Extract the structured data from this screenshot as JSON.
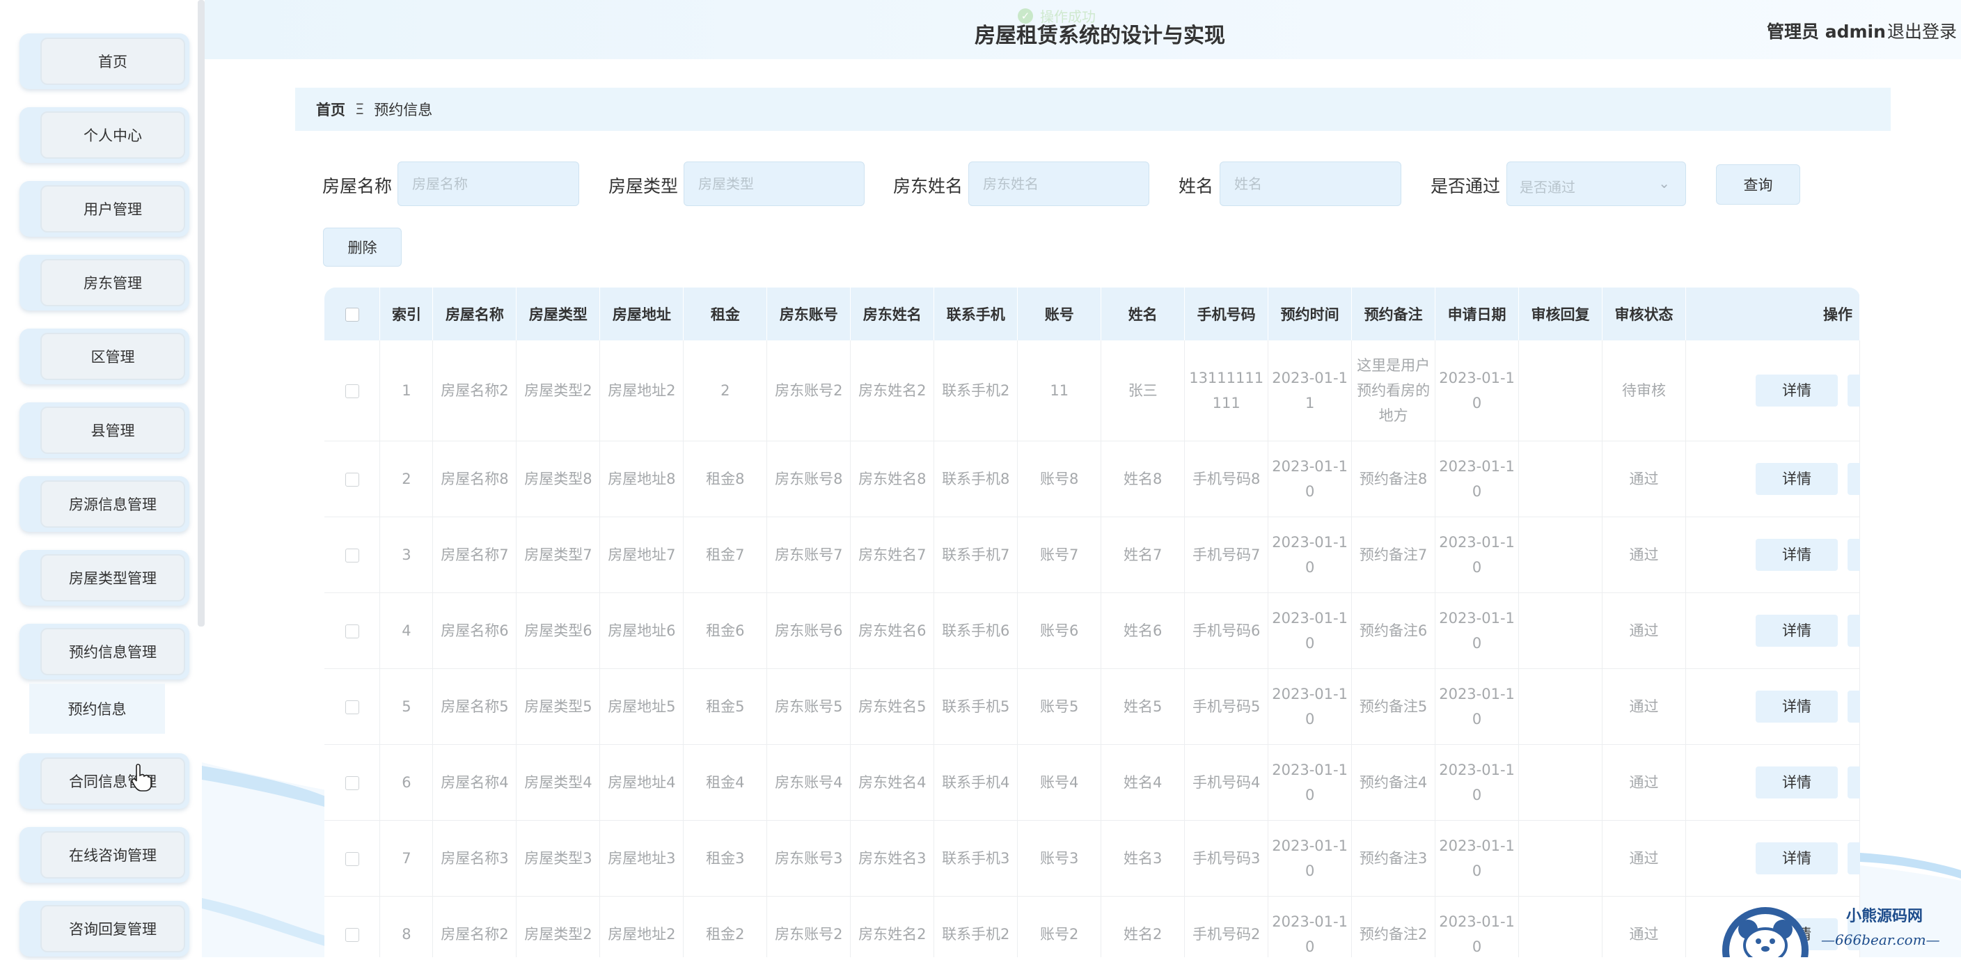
{
  "app": {
    "title": "房屋租赁系统的设计与实现",
    "admin": "管理员 admin",
    "logout": "退出登录"
  },
  "toast": {
    "text": "操作成功"
  },
  "sidebar": {
    "items": [
      {
        "label": "首页"
      },
      {
        "label": "个人中心"
      },
      {
        "label": "用户管理"
      },
      {
        "label": "房东管理"
      },
      {
        "label": "区管理"
      },
      {
        "label": "县管理"
      },
      {
        "label": "房源信息管理"
      },
      {
        "label": "房屋类型管理"
      },
      {
        "label": "预约信息管理"
      },
      {
        "label": "合同信息管理"
      },
      {
        "label": "在线咨询管理"
      },
      {
        "label": "咨询回复管理"
      }
    ],
    "submenu": {
      "label": "预约信息"
    }
  },
  "breadcrumb": {
    "home": "首页",
    "separator": "Ξ",
    "current": "预约信息"
  },
  "search": {
    "house_name": {
      "label": "房屋名称",
      "placeholder": "房屋名称"
    },
    "house_type": {
      "label": "房屋类型",
      "placeholder": "房屋类型"
    },
    "landlord_name": {
      "label": "房东姓名",
      "placeholder": "房东姓名"
    },
    "name": {
      "label": "姓名",
      "placeholder": "姓名"
    },
    "approved": {
      "label": "是否通过",
      "placeholder": "是否通过"
    },
    "query_button": "查询",
    "delete_button": "删除"
  },
  "table": {
    "headers": [
      "索引",
      "房屋名称",
      "房屋类型",
      "房屋地址",
      "租金",
      "房东账号",
      "房东姓名",
      "联系手机",
      "账号",
      "姓名",
      "手机号码",
      "预约时间",
      "预约备注",
      "申请日期",
      "审核回复",
      "审核状态",
      "操作"
    ],
    "rows": [
      [
        "1",
        "房屋名称2",
        "房屋类型2",
        "房屋地址2",
        "2",
        "房东账号2",
        "房东姓名2",
        "联系手机2",
        "11",
        "张三",
        "13111111111",
        "2023-01-11",
        "这里是用户预约看房的地方",
        "2023-01-10",
        "",
        "待审核"
      ],
      [
        "2",
        "房屋名称8",
        "房屋类型8",
        "房屋地址8",
        "租金8",
        "房东账号8",
        "房东姓名8",
        "联系手机8",
        "账号8",
        "姓名8",
        "手机号码8",
        "2023-01-10",
        "预约备注8",
        "2023-01-10",
        "",
        "通过"
      ],
      [
        "3",
        "房屋名称7",
        "房屋类型7",
        "房屋地址7",
        "租金7",
        "房东账号7",
        "房东姓名7",
        "联系手机7",
        "账号7",
        "姓名7",
        "手机号码7",
        "2023-01-10",
        "预约备注7",
        "2023-01-10",
        "",
        "通过"
      ],
      [
        "4",
        "房屋名称6",
        "房屋类型6",
        "房屋地址6",
        "租金6",
        "房东账号6",
        "房东姓名6",
        "联系手机6",
        "账号6",
        "姓名6",
        "手机号码6",
        "2023-01-10",
        "预约备注6",
        "2023-01-10",
        "",
        "通过"
      ],
      [
        "5",
        "房屋名称5",
        "房屋类型5",
        "房屋地址5",
        "租金5",
        "房东账号5",
        "房东姓名5",
        "联系手机5",
        "账号5",
        "姓名5",
        "手机号码5",
        "2023-01-10",
        "预约备注5",
        "2023-01-10",
        "",
        "通过"
      ],
      [
        "6",
        "房屋名称4",
        "房屋类型4",
        "房屋地址4",
        "租金4",
        "房东账号4",
        "房东姓名4",
        "联系手机4",
        "账号4",
        "姓名4",
        "手机号码4",
        "2023-01-10",
        "预约备注4",
        "2023-01-10",
        "",
        "通过"
      ],
      [
        "7",
        "房屋名称3",
        "房屋类型3",
        "房屋地址3",
        "租金3",
        "房东账号3",
        "房东姓名3",
        "联系手机3",
        "账号3",
        "姓名3",
        "手机号码3",
        "2023-01-10",
        "预约备注3",
        "2023-01-10",
        "",
        "通过"
      ],
      [
        "8",
        "房屋名称2",
        "房屋类型2",
        "房屋地址2",
        "租金2",
        "房东账号2",
        "房东姓名2",
        "联系手机2",
        "账号2",
        "姓名2",
        "手机号码2",
        "2023-01-10",
        "预约备注2",
        "2023-01-10",
        "",
        "通过"
      ]
    ],
    "detail_button": "详情"
  },
  "watermark": {
    "line1": "小熊源码网",
    "line2": "—666bear.com—"
  },
  "colors": {
    "accent": "#e5f2fc",
    "header_bg": "#eaf5fc",
    "text": "#333333",
    "muted": "#a5a8ab"
  }
}
